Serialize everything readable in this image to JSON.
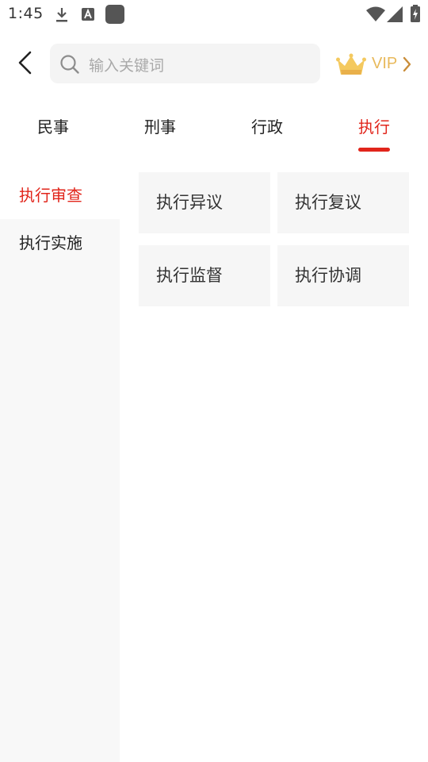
{
  "status_bar": {
    "time": "1:45",
    "icons": [
      "download-icon",
      "text-notification-icon",
      "app-notification-icon",
      "wifi-icon",
      "cell-signal-icon",
      "battery-charging-icon"
    ]
  },
  "header": {
    "search_placeholder": "输入关键词",
    "vip_label": "VIP",
    "vip_color": "#e8b95b"
  },
  "tabs": [
    {
      "label": "民事",
      "active": false
    },
    {
      "label": "刑事",
      "active": false
    },
    {
      "label": "行政",
      "active": false
    },
    {
      "label": "执行",
      "active": true
    }
  ],
  "categories": [
    {
      "label": "执行审查",
      "selected": true
    },
    {
      "label": "执行实施",
      "selected": false
    }
  ],
  "items": [
    {
      "label": "执行异议"
    },
    {
      "label": "执行复议"
    },
    {
      "label": "执行监督"
    },
    {
      "label": "执行协调"
    }
  ],
  "colors": {
    "accent": "#e1251b",
    "rail_bg": "#f8f8f8",
    "cell_bg": "#f6f6f6"
  }
}
